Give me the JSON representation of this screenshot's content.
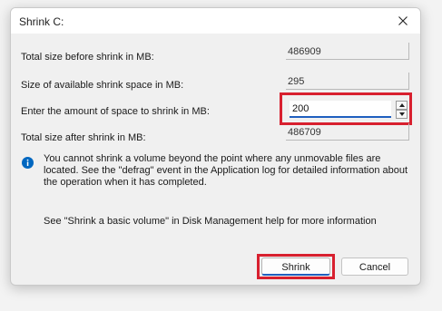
{
  "dialog": {
    "title": "Shrink C:",
    "close_icon": "close-icon"
  },
  "fields": {
    "total_size_label": "Total size before shrink in MB:",
    "total_size_value": "486909",
    "available_label": "Size of available shrink space in MB:",
    "available_value": "295",
    "amount_label": "Enter the amount of space to shrink in MB:",
    "amount_value": "200",
    "after_label": "Total size after shrink in MB:",
    "after_value": "486709"
  },
  "info": {
    "icon": "info-icon",
    "message": "You cannot shrink a volume beyond the point where any unmovable files are located. See the \"defrag\" event in the Application log for detailed information about the operation when it has completed.",
    "help": "See \"Shrink a basic volume\" in Disk Management help for more information"
  },
  "buttons": {
    "shrink_label": "Shrink",
    "cancel_label": "Cancel"
  },
  "colors": {
    "highlight": "#d8202f",
    "accent": "#1f5fbf",
    "info_blue": "#0067c0"
  }
}
